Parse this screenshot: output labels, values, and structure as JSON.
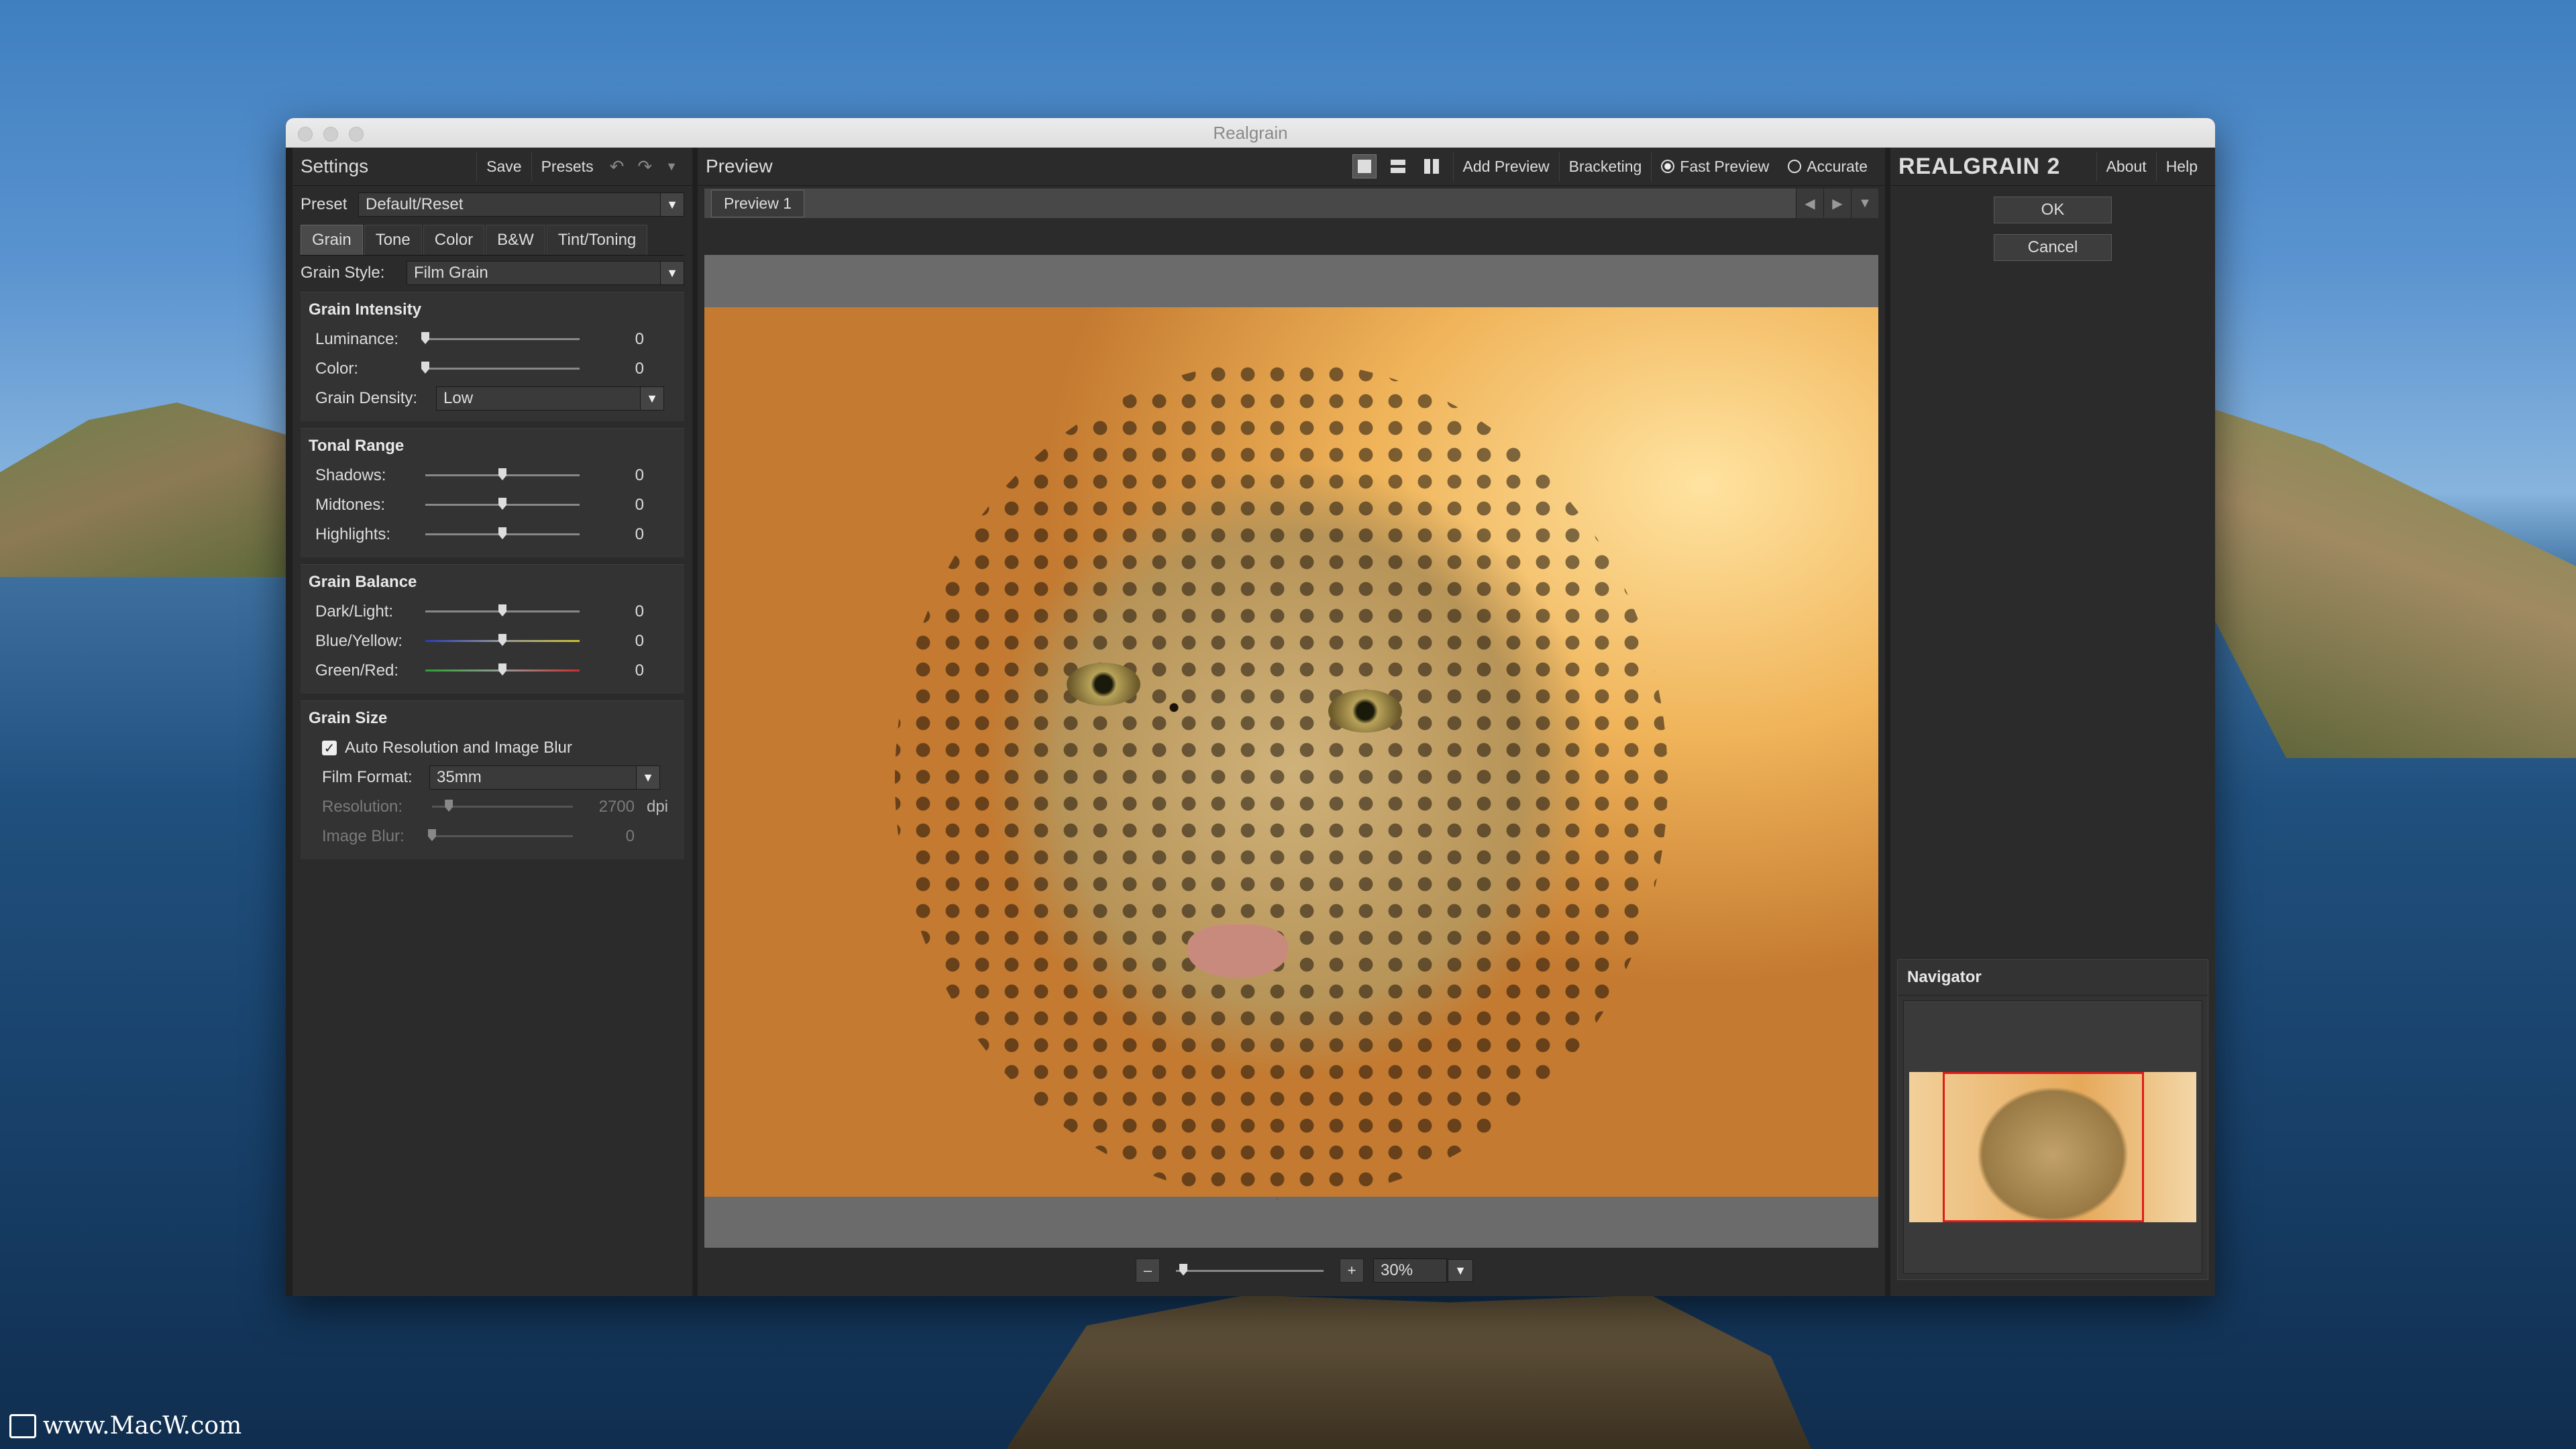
{
  "window": {
    "title": "Realgrain"
  },
  "watermark": "www.MacW.com",
  "settings": {
    "title": "Settings",
    "save": "Save",
    "presets": "Presets",
    "preset_label": "Preset",
    "preset_value": "Default/Reset",
    "tabs": [
      "Grain",
      "Tone",
      "Color",
      "B&W",
      "Tint/Toning"
    ],
    "active_tab": "Grain",
    "grain_style_label": "Grain Style:",
    "grain_style_value": "Film Grain",
    "intensity": {
      "title": "Grain Intensity",
      "luminance": {
        "label": "Luminance:",
        "value": "0"
      },
      "color": {
        "label": "Color:",
        "value": "0"
      },
      "density_label": "Grain Density:",
      "density_value": "Low"
    },
    "tonal": {
      "title": "Tonal Range",
      "shadows": {
        "label": "Shadows:",
        "value": "0"
      },
      "midtones": {
        "label": "Midtones:",
        "value": "0"
      },
      "highlights": {
        "label": "Highlights:",
        "value": "0"
      }
    },
    "balance": {
      "title": "Grain Balance",
      "dark_light": {
        "label": "Dark/Light:",
        "value": "0"
      },
      "blue_yellow": {
        "label": "Blue/Yellow:",
        "value": "0"
      },
      "green_red": {
        "label": "Green/Red:",
        "value": "0"
      }
    },
    "size": {
      "title": "Grain Size",
      "auto_label": "Auto Resolution and Image Blur",
      "auto_checked": true,
      "film_format_label": "Film Format:",
      "film_format_value": "35mm",
      "resolution": {
        "label": "Resolution:",
        "value": "2700",
        "unit": "dpi"
      },
      "image_blur": {
        "label": "Image Blur:",
        "value": "0"
      }
    }
  },
  "preview": {
    "title": "Preview",
    "add_preview": "Add Preview",
    "bracketing": "Bracketing",
    "fast_preview": "Fast Preview",
    "accurate": "Accurate",
    "tab": "Preview 1",
    "zoom_minus": "–",
    "zoom_plus": "+",
    "zoom_value": "30%"
  },
  "right": {
    "brand": "REALGRAIN 2",
    "about": "About",
    "help": "Help",
    "ok": "OK",
    "cancel": "Cancel",
    "navigator": "Navigator"
  },
  "colors": {
    "accent_red": "#e21a1a",
    "panel": "#2b2b2b"
  }
}
